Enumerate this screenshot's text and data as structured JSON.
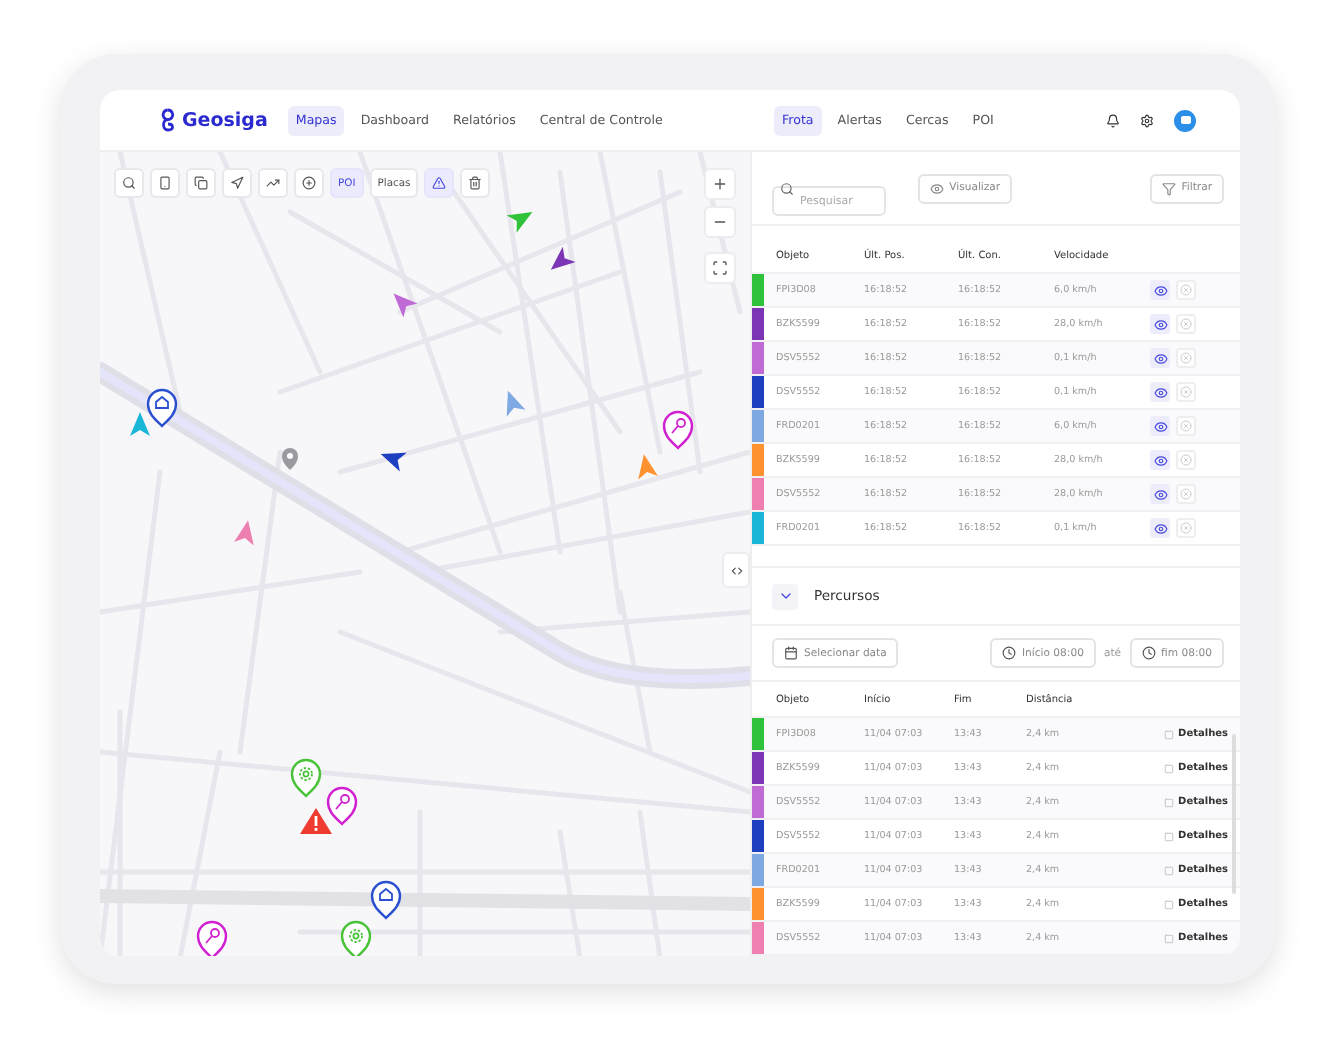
{
  "brand": "Geosiga",
  "nav": [
    {
      "label": "Mapas",
      "selected": true
    },
    {
      "label": "Dashboard",
      "selected": false
    },
    {
      "label": "Relatórios",
      "selected": false
    },
    {
      "label": "Central de Controle",
      "selected": false
    }
  ],
  "panel_tabs": [
    {
      "label": "Frota",
      "selected": true
    },
    {
      "label": "Alertas",
      "selected": false
    },
    {
      "label": "Cercas",
      "selected": false
    },
    {
      "label": "POI",
      "selected": false
    }
  ],
  "map_toolbar": [
    {
      "kind": "icon",
      "selected": false
    },
    {
      "kind": "icon",
      "selected": false
    },
    {
      "kind": "icon",
      "selected": false
    },
    {
      "kind": "icon",
      "selected": false
    },
    {
      "kind": "icon",
      "selected": false
    },
    {
      "kind": "icon",
      "selected": false
    },
    {
      "kind": "text",
      "label": "POI",
      "selected": true
    },
    {
      "kind": "text",
      "label": "Placas",
      "selected": false
    },
    {
      "kind": "icon",
      "selected": true
    },
    {
      "kind": "icon",
      "selected": false
    }
  ],
  "fleet": {
    "search": {
      "placeholder": "Pesquisar"
    },
    "view_button": "Visualizar",
    "filter_button": "Filtrar",
    "columns": [
      "Objeto",
      "Últ. Pos.",
      "Últ. Con.",
      "Velocidade"
    ],
    "rows": [
      {
        "color": "#2fc23a",
        "objeto": "FPI3D08",
        "ult_pos": "16:18:52",
        "ult_con": "16:18:52",
        "velocidade": "6,0 km/h"
      },
      {
        "color": "#7b35b5",
        "objeto": "BZK5599",
        "ult_pos": "16:18:52",
        "ult_con": "16:18:52",
        "velocidade": "28,0 km/h"
      },
      {
        "color": "#c06ad6",
        "objeto": "DSV5552",
        "ult_pos": "16:18:52",
        "ult_con": "16:18:52",
        "velocidade": "0,1 km/h"
      },
      {
        "color": "#1d3fc0",
        "objeto": "DSV5552",
        "ult_pos": "16:18:52",
        "ult_con": "16:18:52",
        "velocidade": "0,1 km/h"
      },
      {
        "color": "#7fa9e3",
        "objeto": "FRD0201",
        "ult_pos": "16:18:52",
        "ult_con": "16:18:52",
        "velocidade": "6,0 km/h"
      },
      {
        "color": "#ff9230",
        "objeto": "BZK5599",
        "ult_pos": "16:18:52",
        "ult_con": "16:18:52",
        "velocidade": "28,0 km/h"
      },
      {
        "color": "#ee7fb0",
        "objeto": "DSV5552",
        "ult_pos": "16:18:52",
        "ult_con": "16:18:52",
        "velocidade": "28,0 km/h"
      },
      {
        "color": "#1ab6d8",
        "objeto": "FRD0201",
        "ult_pos": "16:18:52",
        "ult_con": "16:18:52",
        "velocidade": "0,1 km/h"
      }
    ]
  },
  "routes": {
    "title": "Percursos",
    "expanded": true,
    "date_button": "Selecionar data",
    "start_button": "Início 08:00",
    "separator": "até",
    "end_button": "fim 08:00",
    "columns": [
      "Objeto",
      "Início",
      "Fim",
      "Distância"
    ],
    "rows": [
      {
        "color": "#2fc23a",
        "objeto": "FPI3D08",
        "inicio": "11/04 07:03",
        "fim": "13:43",
        "distancia": "2,4 km",
        "action": "Detalhes"
      },
      {
        "color": "#7b35b5",
        "objeto": "BZK5599",
        "inicio": "11/04 07:03",
        "fim": "13:43",
        "distancia": "2,4 km",
        "action": "Detalhes"
      },
      {
        "color": "#c06ad6",
        "objeto": "DSV5552",
        "inicio": "11/04 07:03",
        "fim": "13:43",
        "distancia": "2,4 km",
        "action": "Detalhes"
      },
      {
        "color": "#1d3fc0",
        "objeto": "DSV5552",
        "inicio": "11/04 07:03",
        "fim": "13:43",
        "distancia": "2,4 km",
        "action": "Detalhes"
      },
      {
        "color": "#7fa9e3",
        "objeto": "FRD0201",
        "inicio": "11/04 07:03",
        "fim": "13:43",
        "distancia": "2,4 km",
        "action": "Detalhes"
      },
      {
        "color": "#ff9230",
        "objeto": "BZK5599",
        "inicio": "11/04 07:03",
        "fim": "13:43",
        "distancia": "2,4 km",
        "action": "Detalhes"
      },
      {
        "color": "#ee7fb0",
        "objeto": "DSV5552",
        "inicio": "11/04 07:03",
        "fim": "13:43",
        "distancia": "2,4 km",
        "action": "Detalhes"
      }
    ]
  }
}
